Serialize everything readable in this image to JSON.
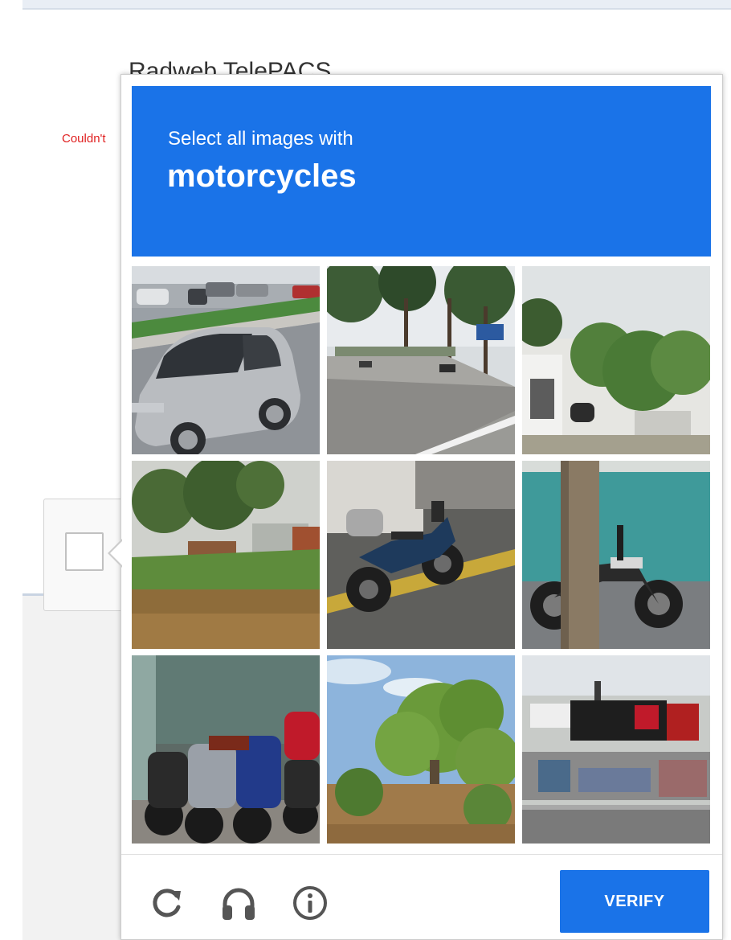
{
  "background_page": {
    "title": "Radweb TelePACS",
    "error_text": "Couldn't"
  },
  "challenge": {
    "instruction": "Select all images with",
    "keyword": "motorcycles",
    "tiles": [
      {
        "content": "silver-car-on-road",
        "selected": false
      },
      {
        "content": "tree-lined-road",
        "selected": false
      },
      {
        "content": "building-with-trees",
        "selected": false
      },
      {
        "content": "river-and-trees",
        "selected": false
      },
      {
        "content": "touring-motorcycle",
        "selected": false
      },
      {
        "content": "motorcycle-behind-pole",
        "selected": false
      },
      {
        "content": "parked-motorcycles",
        "selected": false
      },
      {
        "content": "large-tree-sky",
        "selected": false
      },
      {
        "content": "billboard-building",
        "selected": false
      }
    ],
    "footer": {
      "reload_icon": "reload-icon",
      "audio_icon": "headphones-icon",
      "info_icon": "info-icon",
      "verify_label": "VERIFY"
    }
  },
  "colors": {
    "accent": "#1a73e8",
    "error": "#e02020",
    "icon": "#555555"
  }
}
